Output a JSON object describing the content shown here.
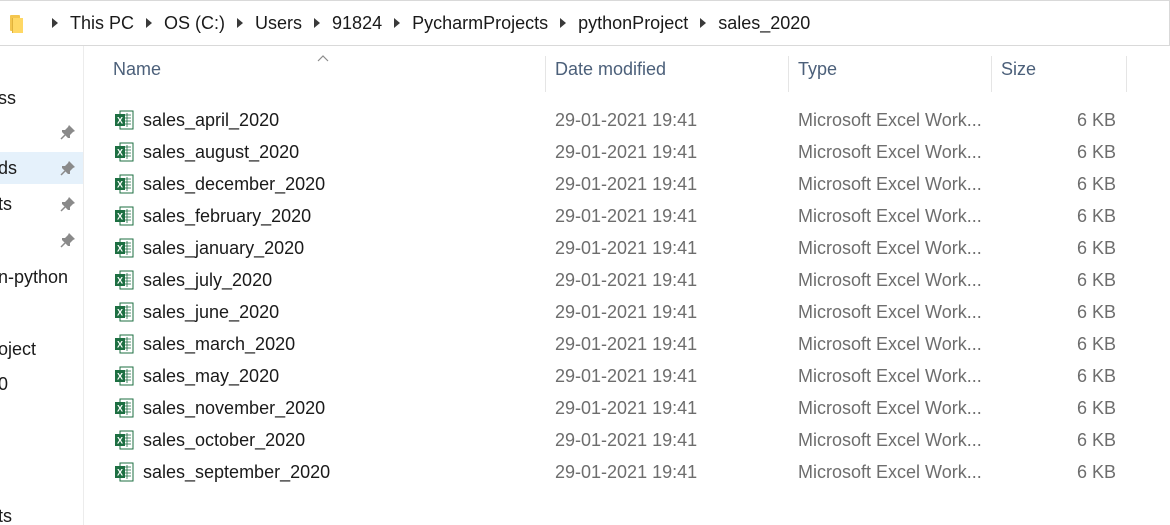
{
  "address_bar": {
    "crumbs": [
      "This PC",
      "OS (C:)",
      "Users",
      "91824",
      "PycharmProjects",
      "pythonProject",
      "sales_2020"
    ]
  },
  "nav_pane": {
    "items": [
      {
        "label": "ss",
        "pinned": false,
        "selected": false
      },
      {
        "label": "",
        "pinned": true,
        "selected": false
      },
      {
        "label": "ds",
        "pinned": true,
        "selected": true
      },
      {
        "label": "ts",
        "pinned": true,
        "selected": false
      },
      {
        "label": "",
        "pinned": true,
        "selected": false
      },
      {
        "label": "n-python",
        "pinned": false,
        "selected": false
      },
      {
        "label": "oject",
        "pinned": false,
        "selected": false
      },
      {
        "label": "0",
        "pinned": false,
        "selected": false
      },
      {
        "label": "ts",
        "pinned": false,
        "selected": false
      }
    ]
  },
  "columns": {
    "name": "Name",
    "date_modified": "Date modified",
    "type": "Type",
    "size": "Size"
  },
  "files": [
    {
      "name": "sales_april_2020",
      "date": "29-01-2021 19:41",
      "type": "Microsoft Excel Work...",
      "size": "6 KB"
    },
    {
      "name": "sales_august_2020",
      "date": "29-01-2021 19:41",
      "type": "Microsoft Excel Work...",
      "size": "6 KB"
    },
    {
      "name": "sales_december_2020",
      "date": "29-01-2021 19:41",
      "type": "Microsoft Excel Work...",
      "size": "6 KB"
    },
    {
      "name": "sales_february_2020",
      "date": "29-01-2021 19:41",
      "type": "Microsoft Excel Work...",
      "size": "6 KB"
    },
    {
      "name": "sales_january_2020",
      "date": "29-01-2021 19:41",
      "type": "Microsoft Excel Work...",
      "size": "6 KB"
    },
    {
      "name": "sales_july_2020",
      "date": "29-01-2021 19:41",
      "type": "Microsoft Excel Work...",
      "size": "6 KB"
    },
    {
      "name": "sales_june_2020",
      "date": "29-01-2021 19:41",
      "type": "Microsoft Excel Work...",
      "size": "6 KB"
    },
    {
      "name": "sales_march_2020",
      "date": "29-01-2021 19:41",
      "type": "Microsoft Excel Work...",
      "size": "6 KB"
    },
    {
      "name": "sales_may_2020",
      "date": "29-01-2021 19:41",
      "type": "Microsoft Excel Work...",
      "size": "6 KB"
    },
    {
      "name": "sales_november_2020",
      "date": "29-01-2021 19:41",
      "type": "Microsoft Excel Work...",
      "size": "6 KB"
    },
    {
      "name": "sales_october_2020",
      "date": "29-01-2021 19:41",
      "type": "Microsoft Excel Work...",
      "size": "6 KB"
    },
    {
      "name": "sales_september_2020",
      "date": "29-01-2021 19:41",
      "type": "Microsoft Excel Work...",
      "size": "6 KB"
    }
  ],
  "colors": {
    "header_text": "#4c607a",
    "secondary_text": "#6d6d6d",
    "selection": "#e5f1fb",
    "excel_green": "#1d6f42"
  },
  "icons": {
    "folder": "folder-icon",
    "excel_file": "excel-file-icon",
    "pin": "pin-icon",
    "breadcrumb_separator": "chevron-right-icon",
    "sort": "sort-caret-icon"
  }
}
